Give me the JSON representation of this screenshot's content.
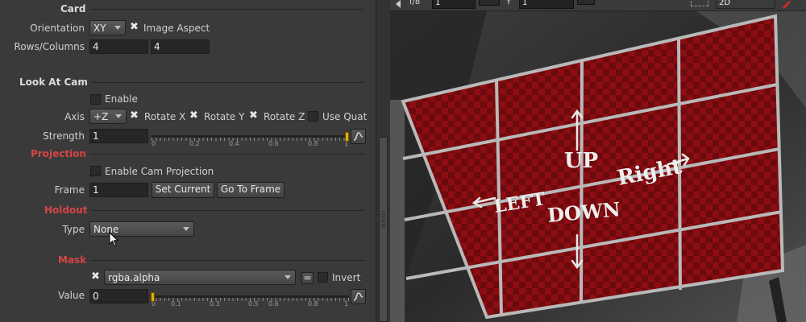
{
  "card": {
    "section": "Card",
    "orientation_label": "Orientation",
    "orientation_value": "XY",
    "image_aspect_label": "Image Aspect",
    "rows_columns_label": "Rows/Columns",
    "rows": "4",
    "columns": "4"
  },
  "look_at_cam": {
    "section": "Look At Cam",
    "enable_label": "Enable",
    "axis_label": "Axis",
    "axis_value": "+Z",
    "rotate_x_label": "Rotate X",
    "rotate_y_label": "Rotate Y",
    "rotate_z_label": "Rotate Z",
    "use_quat_label": "Use Quat",
    "strength_label": "Strength",
    "strength_value": "1",
    "slider_ticks": [
      "0",
      "0.2",
      "0.4",
      "0.6",
      "0.8",
      "1"
    ]
  },
  "projection": {
    "section": "Projection",
    "enable_cam_projection_label": "Enable Cam Projection",
    "frame_label": "Frame",
    "frame_value": "1",
    "set_current_label": "Set Current",
    "go_to_frame_label": "Go To Frame"
  },
  "holdout": {
    "section": "Holdout",
    "type_label": "Type",
    "type_value": "None"
  },
  "mask": {
    "section": "Mask",
    "channel_value": "rgba.alpha",
    "equals_label": "=",
    "invert_label": "Invert",
    "value_label": "Value",
    "value_value": "0",
    "slider_ticks": [
      "0",
      "0.1",
      "0.3",
      "0.5",
      "0.6",
      "0.8",
      "1"
    ]
  },
  "viewer": {
    "fstop": "f/8",
    "frame_field": "1",
    "channel_letter": "Y",
    "y_field": "1",
    "view_mode": "2D",
    "card_labels": {
      "up": "UP",
      "down": "DOWN",
      "left": "LEFT",
      "right": "Right"
    }
  },
  "colors": {
    "section_red": "#d64545",
    "card_red": "#8c0d12",
    "grid_line": "#b9b9b9",
    "slider_handle": "#e0b000"
  }
}
